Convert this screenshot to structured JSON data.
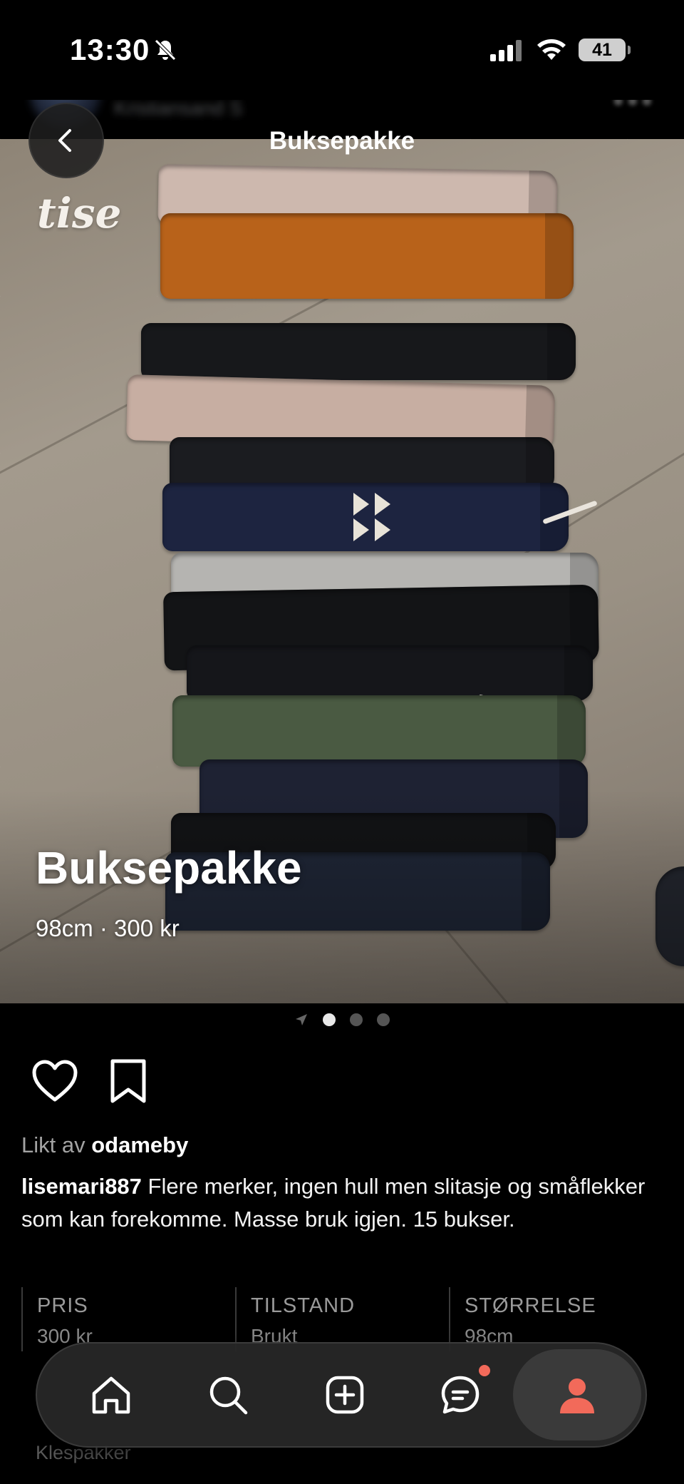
{
  "status_bar": {
    "time": "13:30",
    "battery": "41"
  },
  "seller": {
    "username": "lisemari887",
    "location": "Kristiansand S"
  },
  "header": {
    "title": "Buksepakke"
  },
  "brand": {
    "logo_text": "tise"
  },
  "listing": {
    "title": "Buksepakke",
    "meta": "98cm · 300 kr",
    "image_pages": 3,
    "active_page": 1
  },
  "social": {
    "liked_prefix": "Likt av",
    "liked_user": "odameby",
    "author": "lisemari887",
    "description": "Flere merker, ingen hull men slitasje og småflekker som kan forekomme. Masse bruk igjen. 15 bukser."
  },
  "details": [
    {
      "label": "PRIS",
      "value": "300 kr"
    },
    {
      "label": "TILSTAND",
      "value": "Brukt"
    },
    {
      "label": "STØRRELSE",
      "value": "98cm"
    }
  ],
  "category": {
    "value": "Klespakker"
  },
  "nav": {
    "items": [
      "home-icon",
      "search-icon",
      "add-icon",
      "chat-icon",
      "profile-icon"
    ],
    "accent": "#f26a5a"
  }
}
